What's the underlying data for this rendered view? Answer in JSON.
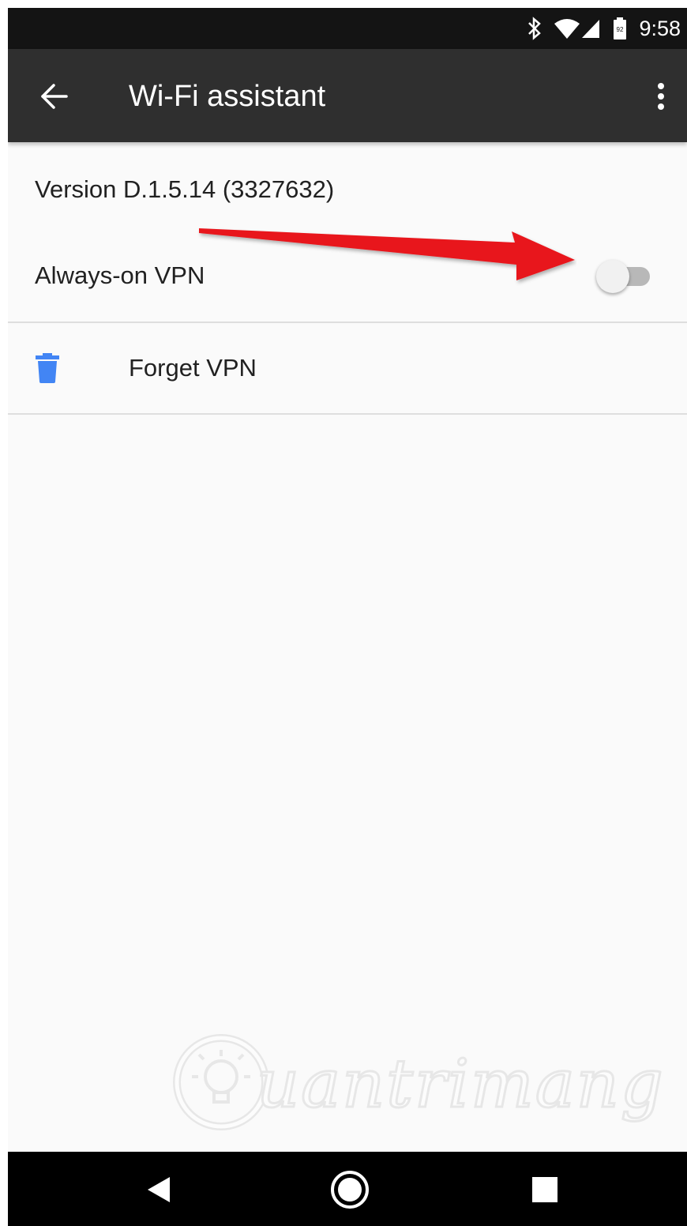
{
  "status_bar": {
    "time": "9:58",
    "icons": [
      "bluetooth-icon",
      "wifi-icon",
      "cell-signal-icon",
      "battery-icon"
    ]
  },
  "app_bar": {
    "title": "Wi-Fi assistant",
    "back_icon": "arrow-back-icon",
    "menu_icon": "more-vert-icon"
  },
  "settings": {
    "version": "Version D.1.5.14 (3327632)",
    "always_on_vpn": {
      "label": "Always-on VPN",
      "enabled": false
    },
    "forget_vpn": {
      "label": "Forget VPN",
      "icon": "trash-icon"
    }
  },
  "annotation": {
    "color": "#e8161c",
    "points_to": "always-on-vpn-toggle"
  },
  "watermark": {
    "text": "uantrimang"
  },
  "nav_bar": {
    "icons": [
      "back-triangle-icon",
      "home-circle-icon",
      "recents-square-icon"
    ]
  },
  "colors": {
    "status_bar": "#141414",
    "app_bar": "#2f2f2f",
    "background": "#fafafa",
    "accent_icon": "#4285f4",
    "nav_bar": "#000000"
  }
}
